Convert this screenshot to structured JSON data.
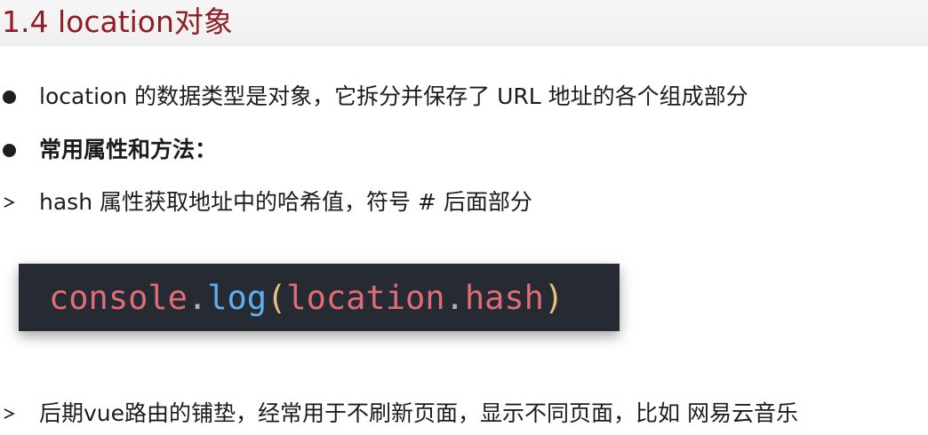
{
  "title": "1.4 location对象",
  "bullets": [
    {
      "type": "dot",
      "text": "location 的数据类型是对象，它拆分并保存了 URL 地址的各个组成部分",
      "bold": false
    },
    {
      "type": "dot",
      "text": "常用属性和方法：",
      "bold": true
    },
    {
      "type": "arrow",
      "text": "hash 属性获取地址中的哈希值，符号 # 后面部分",
      "bold": false
    }
  ],
  "code": {
    "object": "console",
    "dot1": ".",
    "method": "log",
    "open_paren": "(",
    "arg_object": "location",
    "dot2": ".",
    "arg_property": "hash",
    "close_paren": ")"
  },
  "note": {
    "type": "arrow",
    "text": "后期vue路由的铺垫，经常用于不刷新页面，显示不同页面，比如 网易云音乐"
  },
  "colors": {
    "title": "#8f1d24",
    "text": "#1c1c1c",
    "code_background": "#262a33"
  }
}
